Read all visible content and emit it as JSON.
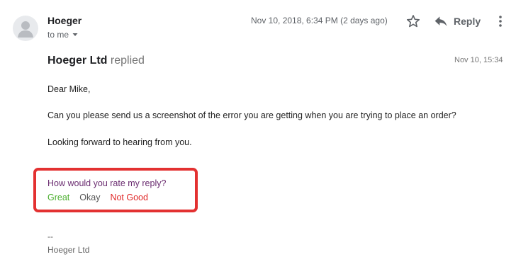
{
  "message": {
    "sender_name": "Hoeger",
    "recipient_text": "to me",
    "timestamp": "Nov 10, 2018, 6:34 PM (2 days ago)",
    "reply_label": "Reply",
    "icons": {
      "avatar": "default-avatar-icon",
      "recipient_toggle": "caret-down-icon",
      "star": "star-icon",
      "reply": "reply-arrow-icon",
      "more": "more-vert-icon"
    }
  },
  "reply": {
    "company": "Hoeger Ltd",
    "action": "replied",
    "time": "Nov 10, 15:34"
  },
  "body": {
    "greeting": "Dear Mike,",
    "line1": "Can you please send us a screenshot of the error you are getting when you are trying to place an order?",
    "line2": "Looking forward to hearing from you."
  },
  "rating": {
    "question": "How would you rate my reply?",
    "options": [
      "Great",
      "Okay",
      "Not Good"
    ],
    "highlight_color": "#e33131"
  },
  "signature": {
    "separator": "--",
    "name": "Hoeger Ltd"
  }
}
